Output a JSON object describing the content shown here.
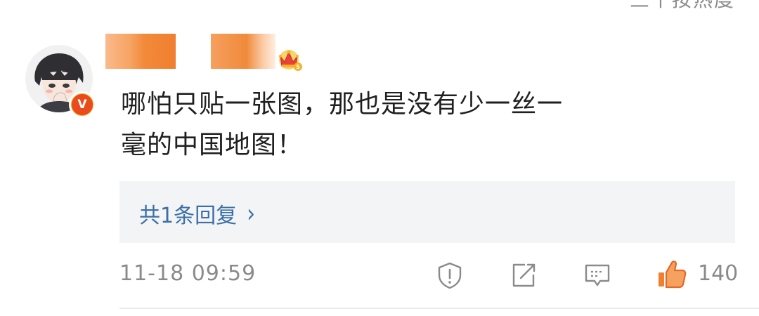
{
  "header": {
    "cut_text": "三个按热度"
  },
  "comment": {
    "avatar_icon": "user-avatar",
    "badge_icon": "vip-v-badge",
    "badge_text": "V",
    "crown_icon": "crown-level-badge",
    "text_line1": "哪怕只贴一张图，那也是没有少一丝一",
    "text_line2": "毫的中国地图！",
    "replies_label": "共1条回复",
    "replies_chevron": "›",
    "timestamp": "11-18 09:59",
    "like_count": "140"
  },
  "colors": {
    "link": "#3b6fa6",
    "meta": "#8a8a8a",
    "like": "#f07f2f",
    "reply_bg": "#f3f4f6"
  }
}
